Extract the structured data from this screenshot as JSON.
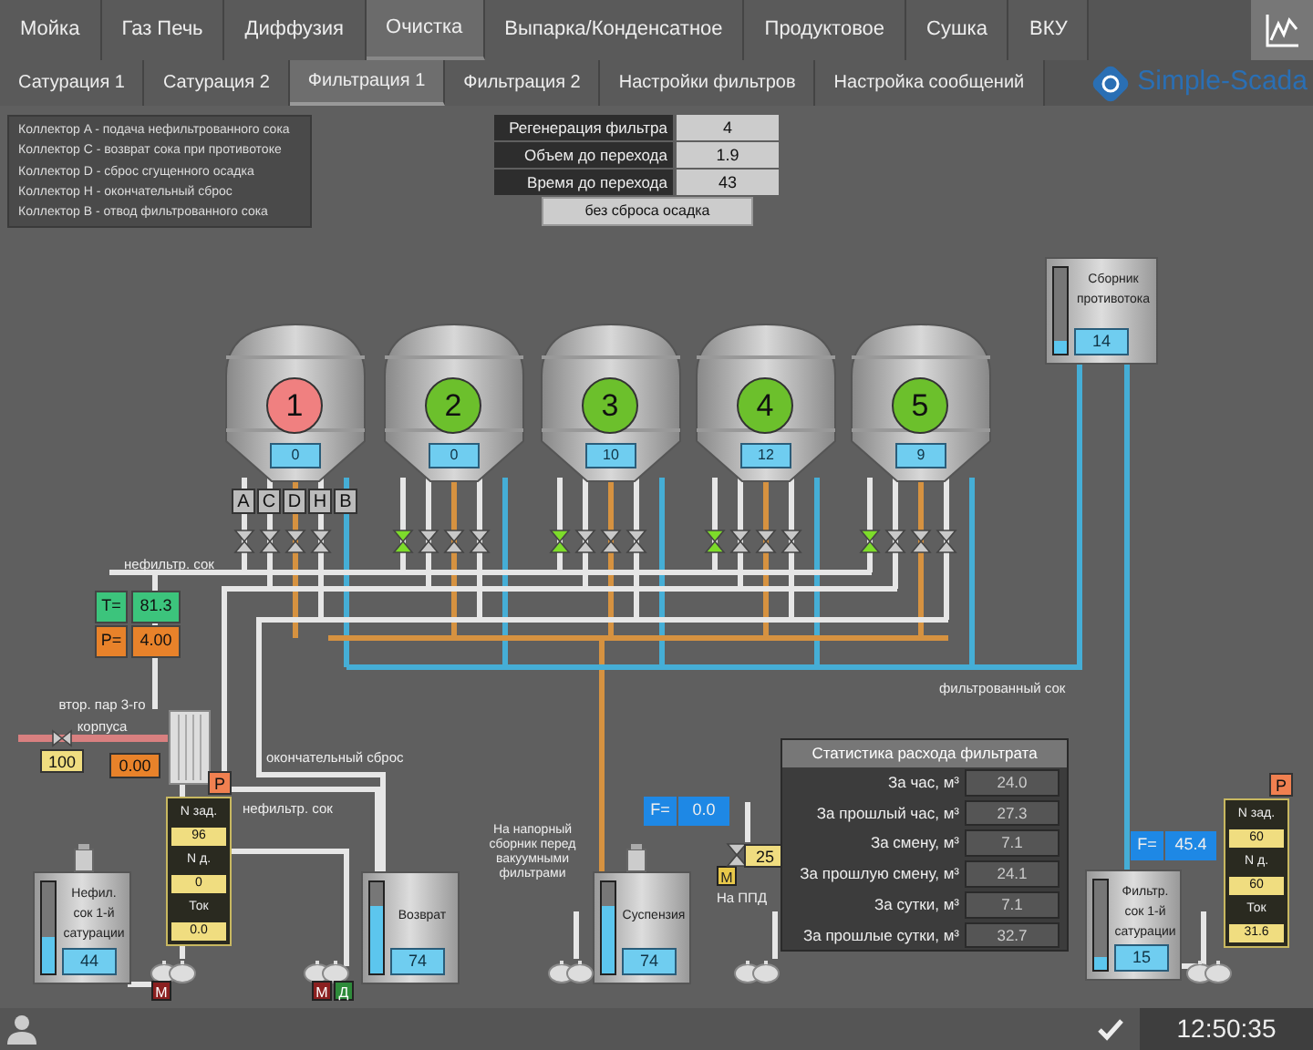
{
  "nav_tabs": [
    {
      "label": "Мойка",
      "selected": false
    },
    {
      "label": "Газ Печь",
      "selected": false
    },
    {
      "label": "Диффузия",
      "selected": false
    },
    {
      "label": "Очистка",
      "selected": true
    },
    {
      "label": "Выпарка/Конденсатное",
      "selected": false
    },
    {
      "label": "Продуктовое",
      "selected": false
    },
    {
      "label": "Сушка",
      "selected": false
    },
    {
      "label": "ВКУ",
      "selected": false
    }
  ],
  "sub_tabs": [
    {
      "label": "Сатурация 1",
      "selected": false
    },
    {
      "label": "Сатурация 2",
      "selected": false
    },
    {
      "label": "Фильтрация 1",
      "selected": true
    },
    {
      "label": "Фильтрация 2",
      "selected": false
    },
    {
      "label": "Настройки фильтров",
      "selected": false
    },
    {
      "label": "Настройка сообщений",
      "selected": false
    }
  ],
  "logo": "Simple-Scada",
  "legend": [
    "Коллектор A - подача нефильтрованного сока",
    "Коллектор C - возврат сока при противотоке",
    "Коллектор D - сброс сгущенного осадка",
    "Коллектор H - окончательный сброс",
    "Коллектор B - отвод фильтрованного сока"
  ],
  "filter_params": [
    {
      "label": "Регенерация фильтра",
      "value": "4"
    },
    {
      "label": "Объем до перехода",
      "value": "1.9"
    },
    {
      "label": "Время до перехода",
      "value": "43"
    }
  ],
  "mode_button": "без сброса осадка",
  "collector_labels": [
    "A",
    "C",
    "D",
    "H",
    "B"
  ],
  "filters": [
    {
      "number": "1",
      "color": "#f08080",
      "value": "0",
      "valves": [
        {
          "open": false
        },
        {
          "open": false
        },
        {
          "open": false
        },
        {
          "open": false
        }
      ]
    },
    {
      "number": "2",
      "color": "#6cc02c",
      "value": "0",
      "valves": [
        {
          "open": true
        },
        {
          "open": false
        },
        {
          "open": false
        },
        {
          "open": false
        }
      ]
    },
    {
      "number": "3",
      "color": "#6cc02c",
      "value": "10",
      "valves": [
        {
          "open": true
        },
        {
          "open": false
        },
        {
          "open": false
        },
        {
          "open": false
        }
      ]
    },
    {
      "number": "4",
      "color": "#6cc02c",
      "value": "12",
      "valves": [
        {
          "open": true
        },
        {
          "open": false
        },
        {
          "open": false
        },
        {
          "open": false
        }
      ]
    },
    {
      "number": "5",
      "color": "#6cc02c",
      "value": "9",
      "valves": [
        {
          "open": true
        },
        {
          "open": false
        },
        {
          "open": false
        },
        {
          "open": false
        }
      ]
    }
  ],
  "sensors": [
    {
      "label": "T=",
      "value": "81.3",
      "color": "#3cc47c"
    },
    {
      "label": "P=",
      "value": "4.00",
      "color": "#e8822a"
    }
  ],
  "pipe_labels": [
    "нефильтр. сок",
    "окончательный сброс",
    "нефильтр. сок",
    "фильтрованный сок",
    "На напорный сборник перед вакуумными фильтрами",
    "На ППД"
  ],
  "steam_valve": {
    "label": "втор. пар 3-го корпуса",
    "value": "100"
  },
  "steam_output": "0.00",
  "pumps": [
    {
      "badge": "Р",
      "rows": [
        {
          "label": "N зад.",
          "value": "96"
        },
        {
          "label": "N д.",
          "value": "0"
        },
        {
          "label": "Ток",
          "value": "0.0"
        }
      ]
    },
    {
      "badge": "Р",
      "rows": [
        {
          "label": "N зад.",
          "value": "60"
        },
        {
          "label": "N д.",
          "value": "60"
        },
        {
          "label": "Ток",
          "value": "31.6"
        }
      ]
    }
  ],
  "tanks": [
    {
      "name": "Нефил. сок 1-й сатурации",
      "value": "44",
      "level": 0.4
    },
    {
      "name": "Возврат",
      "value": "74",
      "level": 0.74
    },
    {
      "name": "Суспензия",
      "value": "74",
      "level": 0.74
    },
    {
      "name": "Сборник противотока",
      "value": "14",
      "level": 0.15
    },
    {
      "name": "Фильтр. сок 1-й сатурации",
      "value": "15",
      "level": 0.15
    }
  ],
  "motor_tags": [
    {
      "label": "М",
      "color": "#8b2020"
    },
    {
      "label": "М",
      "color": "#8b2020"
    },
    {
      "label": "Д",
      "color": "#2e8b3a"
    },
    {
      "label": "М",
      "color": "#e8c84a"
    }
  ],
  "flows": [
    {
      "label": "F=",
      "value": "0.0"
    },
    {
      "label": "F=",
      "value": "45.4"
    }
  ],
  "dosing_value": "25",
  "stats": {
    "title": "Статистика расхода фильтрата",
    "rows": [
      {
        "label": "За час, м³",
        "value": "24.0"
      },
      {
        "label": "За прошлый час, м³",
        "value": "27.3"
      },
      {
        "label": "За смену, м³",
        "value": "7.1"
      },
      {
        "label": "За прошлую смену, м³",
        "value": "24.1"
      },
      {
        "label": "За сутки, м³",
        "value": "7.1"
      },
      {
        "label": "За прошлые сутки, м³",
        "value": "32.7"
      }
    ]
  },
  "footer": {
    "time": "12:50:35"
  }
}
